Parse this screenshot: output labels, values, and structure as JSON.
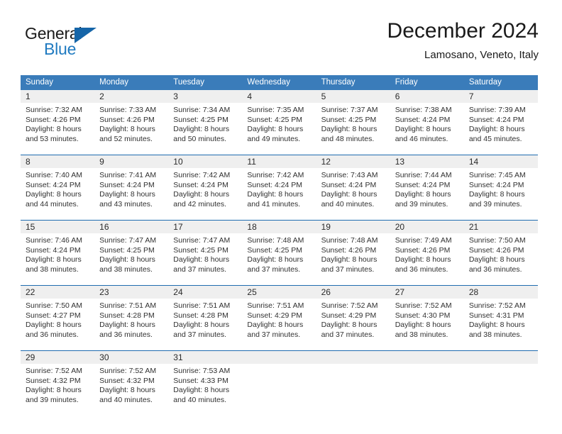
{
  "brand": {
    "name_top": "General",
    "name_bottom": "Blue",
    "triangle_icon": "triangle-icon"
  },
  "header": {
    "title": "December 2024",
    "subtitle": "Lamosano, Veneto, Italy"
  },
  "colors": {
    "header_blue": "#3a7cba",
    "row_border_blue": "#1f6cb0",
    "day_band_gray": "#efefef",
    "brand_blue": "#1f7ac0"
  },
  "calendar": {
    "weekdays": [
      "Sunday",
      "Monday",
      "Tuesday",
      "Wednesday",
      "Thursday",
      "Friday",
      "Saturday"
    ],
    "weeks": [
      [
        {
          "day": "1",
          "sunrise": "Sunrise: 7:32 AM",
          "sunset": "Sunset: 4:26 PM",
          "daylight1": "Daylight: 8 hours",
          "daylight2": "and 53 minutes."
        },
        {
          "day": "2",
          "sunrise": "Sunrise: 7:33 AM",
          "sunset": "Sunset: 4:26 PM",
          "daylight1": "Daylight: 8 hours",
          "daylight2": "and 52 minutes."
        },
        {
          "day": "3",
          "sunrise": "Sunrise: 7:34 AM",
          "sunset": "Sunset: 4:25 PM",
          "daylight1": "Daylight: 8 hours",
          "daylight2": "and 50 minutes."
        },
        {
          "day": "4",
          "sunrise": "Sunrise: 7:35 AM",
          "sunset": "Sunset: 4:25 PM",
          "daylight1": "Daylight: 8 hours",
          "daylight2": "and 49 minutes."
        },
        {
          "day": "5",
          "sunrise": "Sunrise: 7:37 AM",
          "sunset": "Sunset: 4:25 PM",
          "daylight1": "Daylight: 8 hours",
          "daylight2": "and 48 minutes."
        },
        {
          "day": "6",
          "sunrise": "Sunrise: 7:38 AM",
          "sunset": "Sunset: 4:24 PM",
          "daylight1": "Daylight: 8 hours",
          "daylight2": "and 46 minutes."
        },
        {
          "day": "7",
          "sunrise": "Sunrise: 7:39 AM",
          "sunset": "Sunset: 4:24 PM",
          "daylight1": "Daylight: 8 hours",
          "daylight2": "and 45 minutes."
        }
      ],
      [
        {
          "day": "8",
          "sunrise": "Sunrise: 7:40 AM",
          "sunset": "Sunset: 4:24 PM",
          "daylight1": "Daylight: 8 hours",
          "daylight2": "and 44 minutes."
        },
        {
          "day": "9",
          "sunrise": "Sunrise: 7:41 AM",
          "sunset": "Sunset: 4:24 PM",
          "daylight1": "Daylight: 8 hours",
          "daylight2": "and 43 minutes."
        },
        {
          "day": "10",
          "sunrise": "Sunrise: 7:42 AM",
          "sunset": "Sunset: 4:24 PM",
          "daylight1": "Daylight: 8 hours",
          "daylight2": "and 42 minutes."
        },
        {
          "day": "11",
          "sunrise": "Sunrise: 7:42 AM",
          "sunset": "Sunset: 4:24 PM",
          "daylight1": "Daylight: 8 hours",
          "daylight2": "and 41 minutes."
        },
        {
          "day": "12",
          "sunrise": "Sunrise: 7:43 AM",
          "sunset": "Sunset: 4:24 PM",
          "daylight1": "Daylight: 8 hours",
          "daylight2": "and 40 minutes."
        },
        {
          "day": "13",
          "sunrise": "Sunrise: 7:44 AM",
          "sunset": "Sunset: 4:24 PM",
          "daylight1": "Daylight: 8 hours",
          "daylight2": "and 39 minutes."
        },
        {
          "day": "14",
          "sunrise": "Sunrise: 7:45 AM",
          "sunset": "Sunset: 4:24 PM",
          "daylight1": "Daylight: 8 hours",
          "daylight2": "and 39 minutes."
        }
      ],
      [
        {
          "day": "15",
          "sunrise": "Sunrise: 7:46 AM",
          "sunset": "Sunset: 4:24 PM",
          "daylight1": "Daylight: 8 hours",
          "daylight2": "and 38 minutes."
        },
        {
          "day": "16",
          "sunrise": "Sunrise: 7:47 AM",
          "sunset": "Sunset: 4:25 PM",
          "daylight1": "Daylight: 8 hours",
          "daylight2": "and 38 minutes."
        },
        {
          "day": "17",
          "sunrise": "Sunrise: 7:47 AM",
          "sunset": "Sunset: 4:25 PM",
          "daylight1": "Daylight: 8 hours",
          "daylight2": "and 37 minutes."
        },
        {
          "day": "18",
          "sunrise": "Sunrise: 7:48 AM",
          "sunset": "Sunset: 4:25 PM",
          "daylight1": "Daylight: 8 hours",
          "daylight2": "and 37 minutes."
        },
        {
          "day": "19",
          "sunrise": "Sunrise: 7:48 AM",
          "sunset": "Sunset: 4:26 PM",
          "daylight1": "Daylight: 8 hours",
          "daylight2": "and 37 minutes."
        },
        {
          "day": "20",
          "sunrise": "Sunrise: 7:49 AM",
          "sunset": "Sunset: 4:26 PM",
          "daylight1": "Daylight: 8 hours",
          "daylight2": "and 36 minutes."
        },
        {
          "day": "21",
          "sunrise": "Sunrise: 7:50 AM",
          "sunset": "Sunset: 4:26 PM",
          "daylight1": "Daylight: 8 hours",
          "daylight2": "and 36 minutes."
        }
      ],
      [
        {
          "day": "22",
          "sunrise": "Sunrise: 7:50 AM",
          "sunset": "Sunset: 4:27 PM",
          "daylight1": "Daylight: 8 hours",
          "daylight2": "and 36 minutes."
        },
        {
          "day": "23",
          "sunrise": "Sunrise: 7:51 AM",
          "sunset": "Sunset: 4:28 PM",
          "daylight1": "Daylight: 8 hours",
          "daylight2": "and 36 minutes."
        },
        {
          "day": "24",
          "sunrise": "Sunrise: 7:51 AM",
          "sunset": "Sunset: 4:28 PM",
          "daylight1": "Daylight: 8 hours",
          "daylight2": "and 37 minutes."
        },
        {
          "day": "25",
          "sunrise": "Sunrise: 7:51 AM",
          "sunset": "Sunset: 4:29 PM",
          "daylight1": "Daylight: 8 hours",
          "daylight2": "and 37 minutes."
        },
        {
          "day": "26",
          "sunrise": "Sunrise: 7:52 AM",
          "sunset": "Sunset: 4:29 PM",
          "daylight1": "Daylight: 8 hours",
          "daylight2": "and 37 minutes."
        },
        {
          "day": "27",
          "sunrise": "Sunrise: 7:52 AM",
          "sunset": "Sunset: 4:30 PM",
          "daylight1": "Daylight: 8 hours",
          "daylight2": "and 38 minutes."
        },
        {
          "day": "28",
          "sunrise": "Sunrise: 7:52 AM",
          "sunset": "Sunset: 4:31 PM",
          "daylight1": "Daylight: 8 hours",
          "daylight2": "and 38 minutes."
        }
      ],
      [
        {
          "day": "29",
          "sunrise": "Sunrise: 7:52 AM",
          "sunset": "Sunset: 4:32 PM",
          "daylight1": "Daylight: 8 hours",
          "daylight2": "and 39 minutes."
        },
        {
          "day": "30",
          "sunrise": "Sunrise: 7:52 AM",
          "sunset": "Sunset: 4:32 PM",
          "daylight1": "Daylight: 8 hours",
          "daylight2": "and 40 minutes."
        },
        {
          "day": "31",
          "sunrise": "Sunrise: 7:53 AM",
          "sunset": "Sunset: 4:33 PM",
          "daylight1": "Daylight: 8 hours",
          "daylight2": "and 40 minutes."
        },
        {
          "day": "",
          "sunrise": "",
          "sunset": "",
          "daylight1": "",
          "daylight2": ""
        },
        {
          "day": "",
          "sunrise": "",
          "sunset": "",
          "daylight1": "",
          "daylight2": ""
        },
        {
          "day": "",
          "sunrise": "",
          "sunset": "",
          "daylight1": "",
          "daylight2": ""
        },
        {
          "day": "",
          "sunrise": "",
          "sunset": "",
          "daylight1": "",
          "daylight2": ""
        }
      ]
    ]
  }
}
